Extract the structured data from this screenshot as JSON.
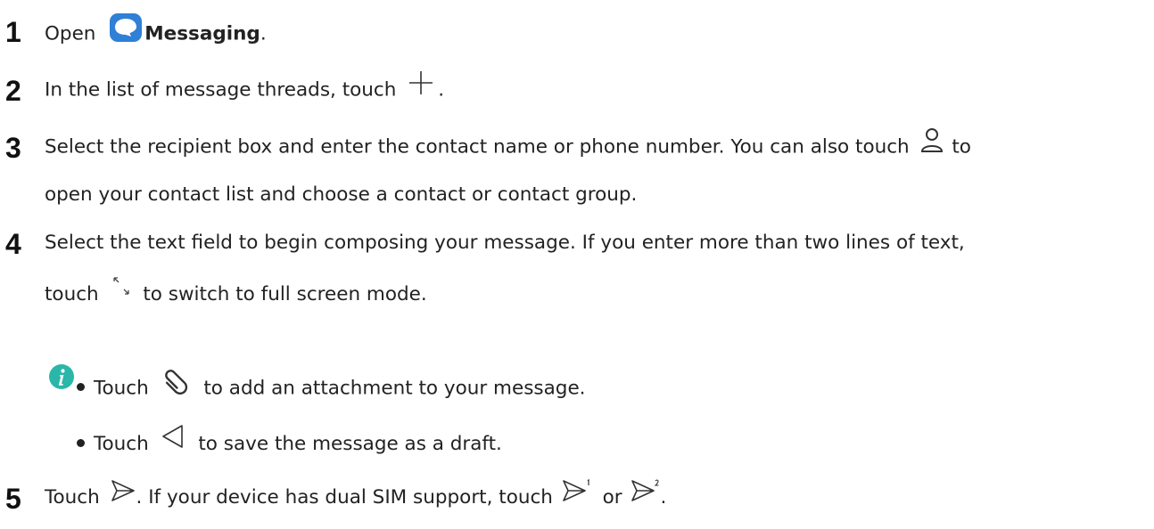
{
  "steps": [
    {
      "number": "1",
      "text_a": "Open ",
      "app_name": "Messaging",
      "text_b": ".",
      "icon": "messaging-app-icon"
    },
    {
      "number": "2",
      "text_a": "In the list of message threads, touch ",
      "text_b": ".",
      "icon": "plus-icon"
    },
    {
      "number": "3",
      "text_a": "Select the recipient box and enter the contact name or phone number. You can also touch ",
      "text_b": " to",
      "line2": "open your contact list and choose a contact or contact group.",
      "icon": "contact-person-icon"
    },
    {
      "number": "4",
      "line1": "Select the text field to begin composing your message. If you enter more than two lines of text,",
      "text_a": "touch ",
      "text_b": " to switch to full screen mode.",
      "icon": "expand-fullscreen-icon"
    },
    {
      "number": "5",
      "text_a": "Touch ",
      "text_b": ". If your device has dual SIM support, touch ",
      "text_c": " or ",
      "text_d": ".",
      "icons": [
        "send-icon",
        "send-sim1-icon",
        "send-sim2-icon"
      ]
    }
  ],
  "notes": [
    {
      "text_a": "Touch ",
      "text_b": " to add an attachment to your message.",
      "icon": "paperclip-icon"
    },
    {
      "text_a": "Touch ",
      "text_b": " to save the message as a draft.",
      "icon": "back-arrow-icon"
    }
  ],
  "colors": {
    "info_icon": "#2ab7a9",
    "messaging_icon": "#2f80d6",
    "text": "#222222"
  }
}
